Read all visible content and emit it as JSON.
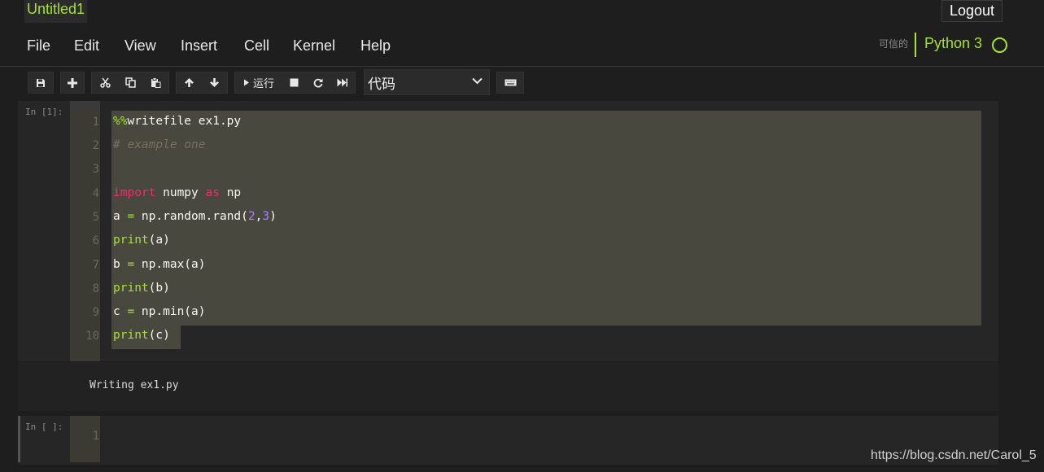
{
  "notebook": {
    "title": "Untitled1",
    "logout_label": "Logout"
  },
  "menu": [
    "File",
    "Edit",
    "View",
    "Insert",
    "Cell",
    "Kernel",
    "Help"
  ],
  "kernel": {
    "trusted_label": "可信的",
    "name": "Python 3"
  },
  "toolbar": {
    "icons": [
      "save-icon",
      "plus-icon",
      "cut-icon",
      "copy-icon",
      "paste-icon",
      "arrow-up-icon",
      "arrow-down-icon",
      "play-icon",
      "stop-icon",
      "restart-icon",
      "fast-forward-icon",
      "keyboard-icon"
    ],
    "run_label": "运行",
    "cell_type": "代码"
  },
  "cells": [
    {
      "prompt": "In [1]:",
      "line_numbers": [
        "1",
        "2",
        "3",
        "4",
        "5",
        "6",
        "7",
        "8",
        "9",
        "10"
      ],
      "lines": [
        [
          "%%",
          "writefile ex1.py"
        ],
        [
          "# example one"
        ],
        [
          ""
        ],
        [
          "import",
          " numpy ",
          "as",
          " np"
        ],
        [
          "a ",
          "=",
          " np.random.rand(",
          "2",
          ",",
          "3",
          ")"
        ],
        [
          "print",
          "(a)"
        ],
        [
          "b ",
          "=",
          " np.max(a)"
        ],
        [
          "print",
          "(b)"
        ],
        [
          "c ",
          "=",
          " np.min(a)"
        ],
        [
          "print",
          "(c)"
        ]
      ],
      "output": "Writing ex1.py"
    },
    {
      "prompt": "In [ ]:",
      "line_numbers": [
        "1"
      ]
    }
  ],
  "colors": {
    "accent": "#a6e22e",
    "keyword": "#f92672",
    "number": "#ae81ff",
    "comment": "#75715e",
    "selection": "#49483e"
  },
  "watermark": "https://blog.csdn.net/Carol_5"
}
